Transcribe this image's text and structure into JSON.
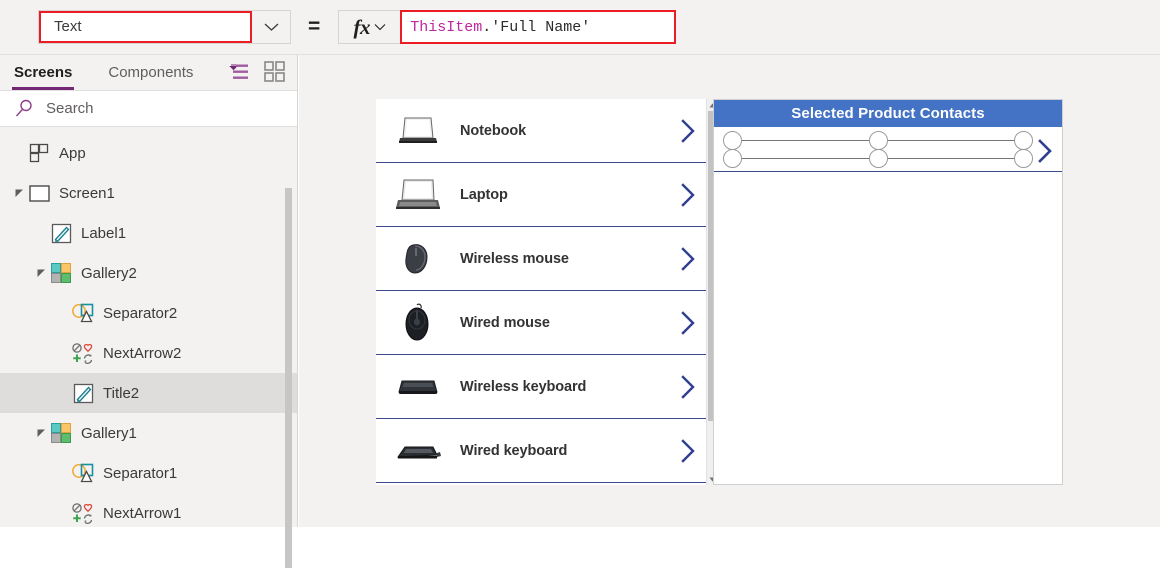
{
  "formula_bar": {
    "property_value": "Text",
    "dropdown_icon": "chevron-down-icon",
    "equals": "=",
    "fx_label": "fx",
    "fx_chevron_icon": "chevron-down-icon",
    "formula_token_identifier": "ThisItem",
    "formula_token_rest": ".'Full Name'",
    "formula_full": "ThisItem.'Full Name'",
    "accent_highlight": "#ec1c24",
    "identifier_color": "#c026a0"
  },
  "sidebar": {
    "tabs": [
      {
        "label": "Screens",
        "active": true
      },
      {
        "label": "Components",
        "active": false
      }
    ],
    "tab_icons": [
      {
        "name": "tree-view-icon"
      },
      {
        "name": "thumbnail-view-icon"
      }
    ],
    "search": {
      "placeholder": "Search",
      "icon": "search-icon"
    },
    "accent": "#742774",
    "tree": [
      {
        "label": "App",
        "icon": "app-icon",
        "level": 0,
        "twisty": "none",
        "selected": false
      },
      {
        "label": "Screen1",
        "icon": "screen-icon",
        "level": 0,
        "twisty": "expanded",
        "selected": false
      },
      {
        "label": "Label1",
        "icon": "label-icon",
        "level": 1,
        "twisty": "none",
        "selected": false
      },
      {
        "label": "Gallery2",
        "icon": "gallery-icon",
        "level": 1,
        "twisty": "expanded",
        "selected": false
      },
      {
        "label": "Separator2",
        "icon": "separator-icon",
        "level": 2,
        "twisty": "none",
        "selected": false
      },
      {
        "label": "NextArrow2",
        "icon": "next-arrow-icon",
        "level": 2,
        "twisty": "none",
        "selected": false
      },
      {
        "label": "Title2",
        "icon": "label-icon",
        "level": 2,
        "twisty": "none",
        "selected": true
      },
      {
        "label": "Gallery1",
        "icon": "gallery-icon",
        "level": 1,
        "twisty": "expanded",
        "selected": false
      },
      {
        "label": "Separator1",
        "icon": "separator-icon",
        "level": 2,
        "twisty": "none",
        "selected": false
      },
      {
        "label": "NextArrow1",
        "icon": "next-arrow-icon",
        "level": 2,
        "twisty": "none",
        "selected": false
      }
    ]
  },
  "canvas": {
    "product_gallery": {
      "name": "Gallery1",
      "chevron_icon": "chevron-right-icon",
      "separator_color": "#3b4a8c",
      "items": [
        {
          "title": "Notebook",
          "image": "notebook-thumbnail"
        },
        {
          "title": "Laptop",
          "image": "laptop-thumbnail"
        },
        {
          "title": "Wireless mouse",
          "image": "wireless-mouse-thumbnail"
        },
        {
          "title": "Wired mouse",
          "image": "wired-mouse-thumbnail"
        },
        {
          "title": "Wireless keyboard",
          "image": "wireless-keyboard-thumbnail"
        },
        {
          "title": "Wired keyboard",
          "image": "wired-keyboard-thumbnail"
        }
      ],
      "scrollbar": {
        "up_arrow_icon": "scroll-up-arrow-icon",
        "down_arrow_icon": "scroll-down-arrow-icon"
      }
    },
    "contacts_gallery": {
      "header_title": "Selected Product Contacts",
      "header_color": "#4472c4",
      "chevron_icon": "chevron-right-icon",
      "selection_handles": 6,
      "items": []
    }
  }
}
